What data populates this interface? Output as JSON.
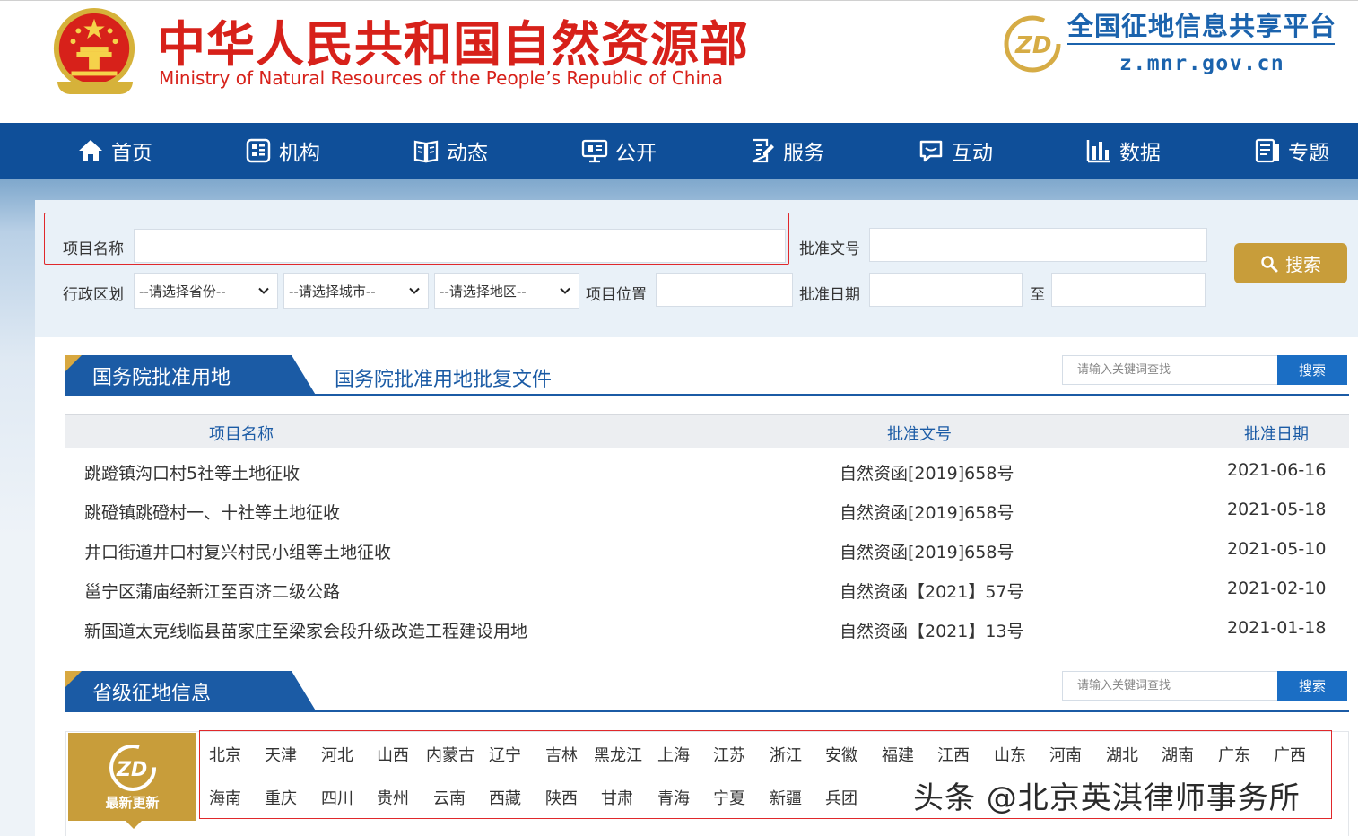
{
  "header": {
    "title_cn": "中华人民共和国自然资源部",
    "title_en": "Ministry of Natural Resources of the People’s Republic of China",
    "platform_logo_text": "ZD",
    "platform_name": "全国征地信息共享平台",
    "platform_url": "z.mnr.gov.cn",
    "emblem_icon": "national-emblem-icon"
  },
  "nav": {
    "items": [
      {
        "label": "首页",
        "icon": "home-icon"
      },
      {
        "label": "机构",
        "icon": "organization-icon"
      },
      {
        "label": "动态",
        "icon": "book-icon"
      },
      {
        "label": "公开",
        "icon": "monitor-icon"
      },
      {
        "label": "服务",
        "icon": "document-edit-icon"
      },
      {
        "label": "互动",
        "icon": "chat-icon"
      },
      {
        "label": "数据",
        "icon": "bar-chart-icon"
      },
      {
        "label": "专题",
        "icon": "topic-icon"
      }
    ]
  },
  "search": {
    "project_name_label": "项目名称",
    "project_name_value": "",
    "approval_no_label": "批准文号",
    "approval_no_value": "",
    "region_label": "行政区划",
    "province_select": "--请选择省份--",
    "city_select": "--请选择城市--",
    "district_select": "--请选择地区--",
    "location_label": "项目位置",
    "location_value": "",
    "approval_date_label": "批准日期",
    "date_from": "",
    "to_label": "至",
    "date_to": "",
    "button_label": "搜索"
  },
  "section_state": {
    "tab_label": "国务院批准用地",
    "link_label": "国务院批准用地批复文件",
    "keyword_placeholder": "请输入关键词查找",
    "keyword_button": "搜索"
  },
  "table": {
    "columns": [
      "项目名称",
      "批准文号",
      "批准日期"
    ],
    "rows": [
      {
        "name": "跳蹬镇沟口村5社等土地征收",
        "doc_no": "自然资函[2019]658号",
        "date": "2021-06-16"
      },
      {
        "name": "跳磴镇跳磴村一、十社等土地征收",
        "doc_no": "自然资函[2019]658号",
        "date": "2021-05-18"
      },
      {
        "name": "井口街道井口村复兴村民小组等土地征收",
        "doc_no": "自然资函[2019]658号",
        "date": "2021-05-10"
      },
      {
        "name": "邕宁区蒲庙经新江至百济二级公路",
        "doc_no": "自然资函【2021】57号",
        "date": "2021-02-10"
      },
      {
        "name": "新国道太克线临县苗家庄至梁家会段升级改造工程建设用地",
        "doc_no": "自然资函【2021】13号",
        "date": "2021-01-18"
      }
    ]
  },
  "section_prov": {
    "tab_label": "省级征地信息",
    "keyword_placeholder": "请输入关键词查找",
    "keyword_button": "搜索",
    "badge_logo": "ZD",
    "badge_text": "最新更新",
    "provinces_row1": [
      "北京",
      "天津",
      "河北",
      "山西",
      "内蒙古",
      "辽宁",
      "吉林",
      "黑龙江",
      "上海",
      "江苏",
      "浙江",
      "安徽",
      "福建",
      "江西",
      "山东",
      "河南",
      "湖北",
      "湖南",
      "广东",
      "广西"
    ],
    "provinces_row2": [
      "海南",
      "重庆",
      "四川",
      "贵州",
      "云南",
      "西藏",
      "陕西",
      "甘肃",
      "青海",
      "宁夏",
      "新疆",
      "兵团"
    ]
  },
  "watermark": "头条 @北京英淇律师事务所",
  "colors": {
    "brand_red": "#d7211a",
    "nav_blue": "#0f4f99",
    "section_blue": "#1b5ba5",
    "gold": "#c89d3a",
    "button_blue": "#1b6ec4"
  }
}
